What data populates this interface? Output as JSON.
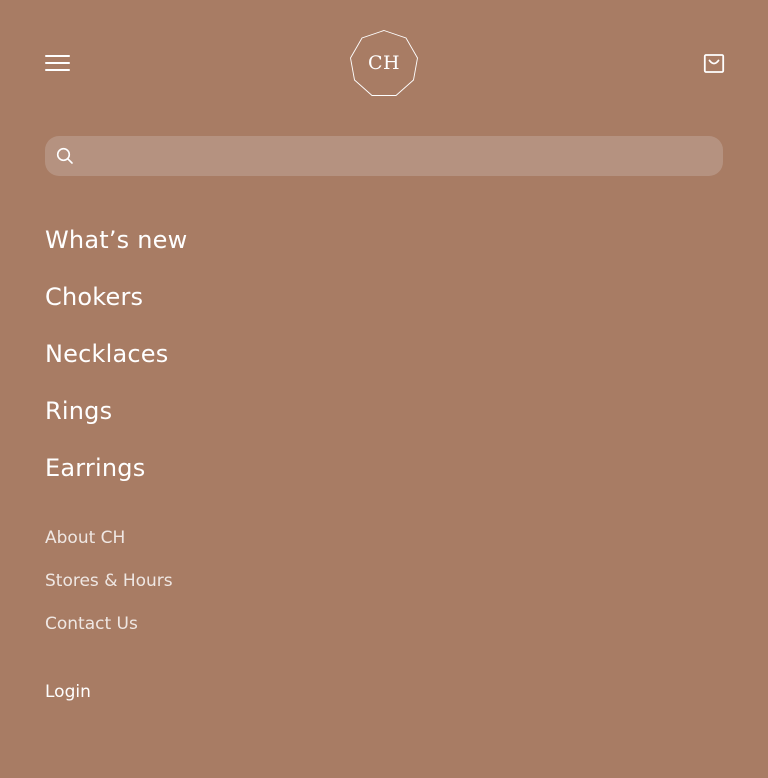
{
  "header": {
    "menu_icon": "hamburger-menu-icon",
    "logo_text": "CH",
    "cart_icon": "shopping-bag-icon"
  },
  "search": {
    "icon": "search-icon",
    "placeholder": "",
    "value": ""
  },
  "primary_nav": {
    "items": [
      {
        "label": "What’s new"
      },
      {
        "label": "Chokers"
      },
      {
        "label": "Necklaces"
      },
      {
        "label": "Rings"
      },
      {
        "label": "Earrings"
      }
    ]
  },
  "secondary_nav": {
    "items": [
      {
        "label": "About CH"
      },
      {
        "label": "Stores & Hours"
      },
      {
        "label": "Contact Us"
      }
    ]
  },
  "account": {
    "login_label": "Login"
  },
  "colors": {
    "background": "#a87c64",
    "search_background": "#b59280",
    "text": "#ffffff"
  }
}
